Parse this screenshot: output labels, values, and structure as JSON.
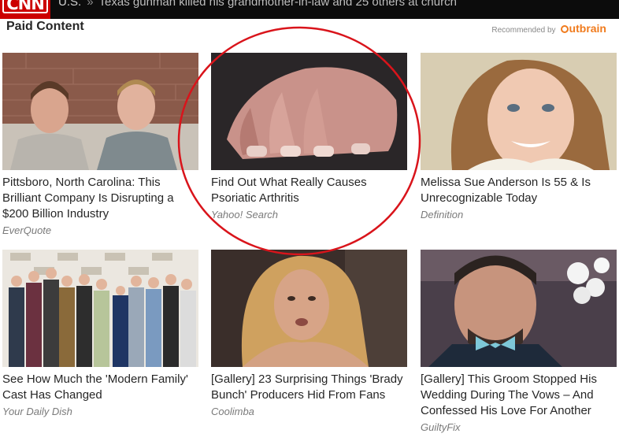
{
  "topbar": {
    "logo": "CNN",
    "section": "U.S.",
    "separator": "»",
    "headline": "Texas gunman killed his grandmother-in-law and 25 others at church"
  },
  "header": {
    "title": "Paid Content",
    "recommended_by": "Recommended by",
    "outbrain": "utbrain"
  },
  "cards": [
    {
      "title": "Pittsboro, North Carolina: This Brilliant Company Is Disrupting a $200 Billion Industry",
      "source": "EverQuote"
    },
    {
      "title": "Find Out What Really Causes Psoriatic Arthritis",
      "source": "Yahoo! Search"
    },
    {
      "title": "Melissa Sue Anderson Is 55 & Is Unrecognizable Today",
      "source": "Definition"
    },
    {
      "title": "See How Much the 'Modern Family' Cast Has Changed",
      "source": "Your Daily Dish"
    },
    {
      "title": "[Gallery] 23 Surprising Things 'Brady Bunch' Producers Hid From Fans",
      "source": "Coolimba"
    },
    {
      "title": "[Gallery] This Groom Stopped His Wedding During The Vows – And Confessed His Love For Another",
      "source": "GuiltyFix"
    }
  ],
  "colors": {
    "brand_red": "#cc0000",
    "outbrain_orange": "#f07b1d",
    "annotation_circle": "#d9141b"
  }
}
